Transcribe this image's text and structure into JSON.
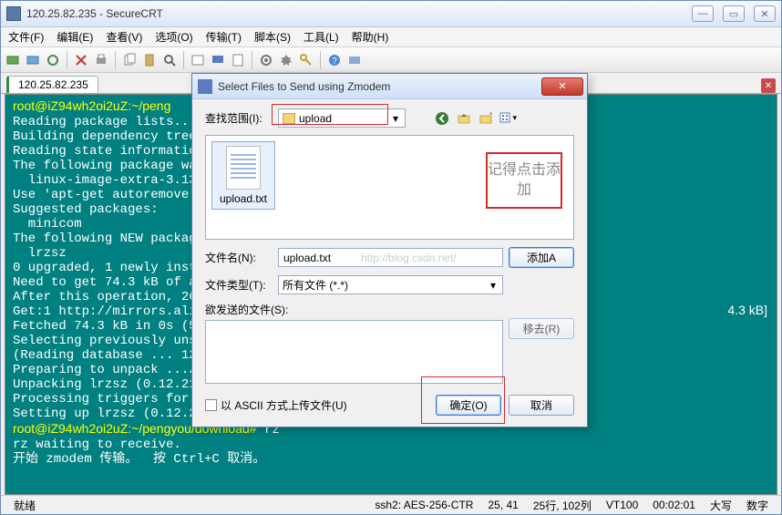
{
  "window": {
    "title": "120.25.82.235 - SecureCRT"
  },
  "menubar": {
    "file": "文件(F)",
    "edit": "编辑(E)",
    "view": "查看(V)",
    "options": "选项(O)",
    "transfer": "传输(T)",
    "script": "脚本(S)",
    "tools": "工具(L)",
    "help": "帮助(H)"
  },
  "tab": {
    "label": "120.25.82.235"
  },
  "terminal_lines": [
    "root@iZ94wh2oi2uZ:~/peng",
    "Reading package lists...",
    "Building dependency tree",
    "Reading state informatio",
    "The following package wa",
    "  linux-image-extra-3.13",
    "Use 'apt-get autoremove'",
    "Suggested packages:",
    "  minicom",
    "The following NEW packag",
    "  lrzsz",
    "0 upgraded, 1 newly inst",
    "Need to get 74.3 kB of a",
    "After this operation, 26",
    "Get:1 http://mirrors.ali",
    "Fetched 74.3 kB in 0s (5",
    "Selecting previously uns",
    "(Reading database ... 12",
    "Preparing to unpack .../",
    "Unpacking lrzsz (0.12.21",
    "Processing triggers for ",
    "Setting up lrzsz (0.12.2",
    "root@iZ94wh2oi2uZ:~/pengyou/download# rz",
    "rz waiting to receive.",
    "开始 zmodem 传输。  按 Ctrl+C 取消。"
  ],
  "terminal_right": "4.3 kB]",
  "statusbar": {
    "ready": "就绪",
    "proto": "ssh2: AES-256-CTR",
    "pos": "25, 41",
    "size": "25行, 102列",
    "term": "VT100",
    "time": "00:02:01",
    "caps": "大写",
    "num": "数字"
  },
  "dialog": {
    "title": "Select Files to Send using Zmodem",
    "lookin_label": "查找范围(I):",
    "lookin_value": "upload",
    "file_item": "upload.txt",
    "hint": "记得点击添加",
    "filename_label": "文件名(N):",
    "filename_value": "upload.txt",
    "filetype_label": "文件类型(T):",
    "filetype_value": "所有文件 (*.*)",
    "add_btn": "添加A",
    "tosend_label": "欲发送的文件(S):",
    "remove_btn": "移去(R)",
    "ascii_label": "以 ASCII 方式上传文件(U)",
    "ok_btn": "确定(O)",
    "cancel_btn": "取消",
    "watermark": "http://blog.csdn.net/"
  }
}
